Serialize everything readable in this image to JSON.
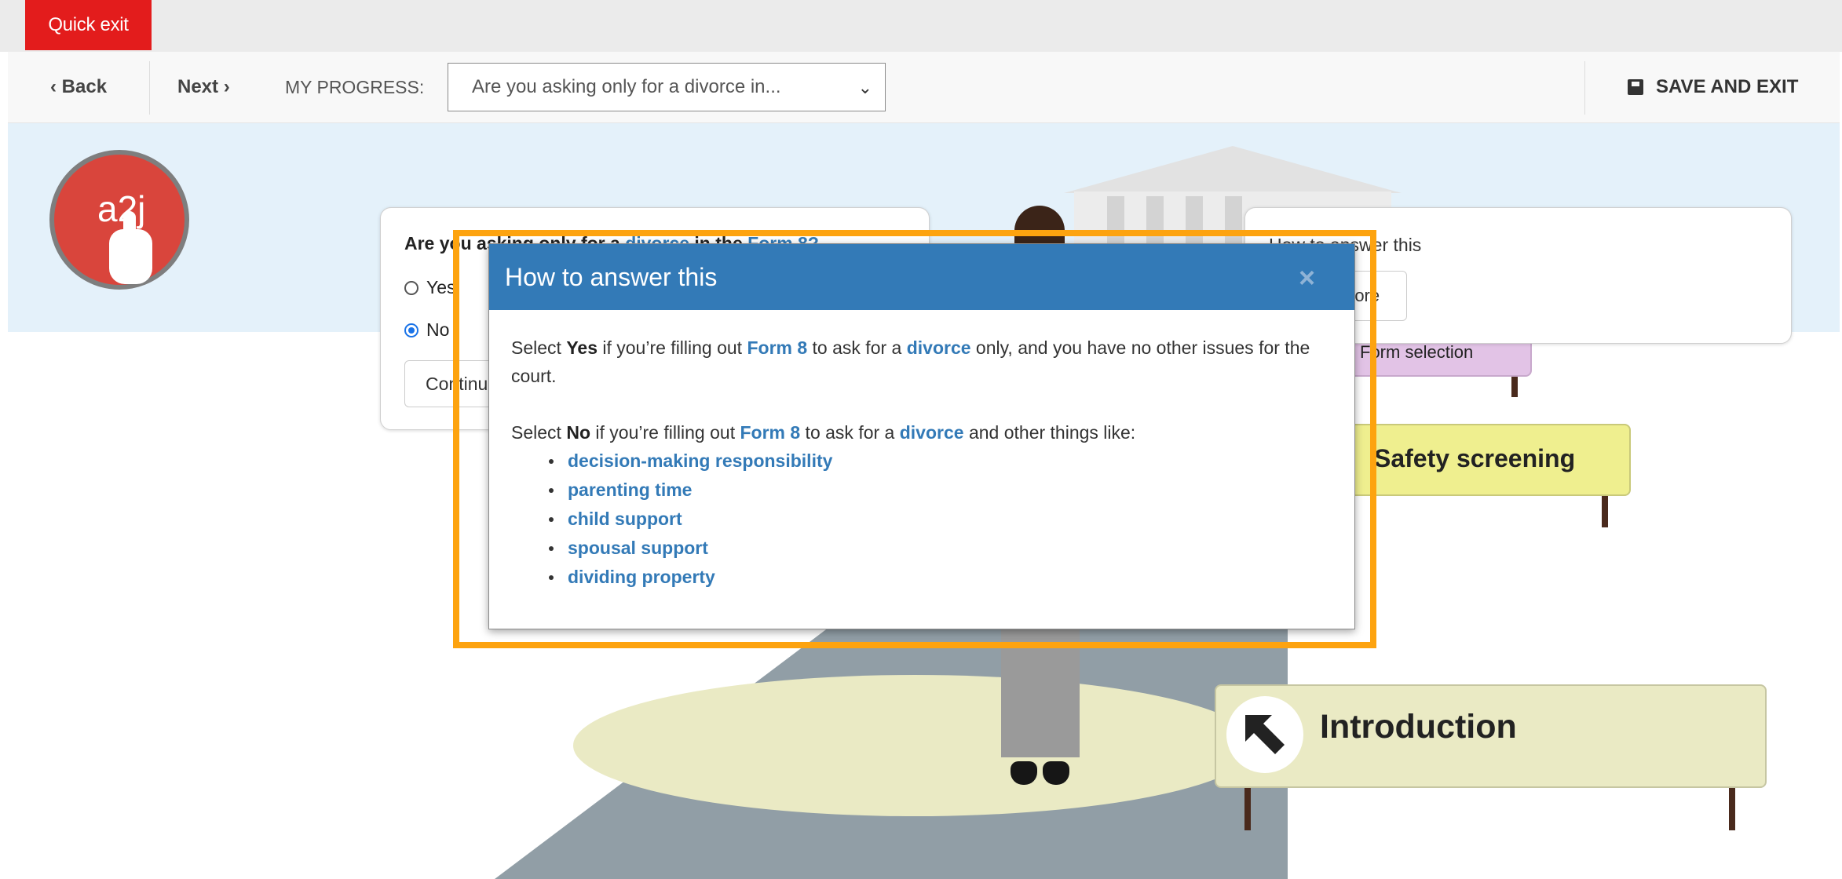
{
  "topbar": {
    "quick_exit": "Quick exit"
  },
  "nav": {
    "back": "‹ Back",
    "next": "Next ›",
    "progress_label": "MY PROGRESS:",
    "progress_value": "Are you asking only for a divorce in...",
    "save_exit": "SAVE AND EXIT"
  },
  "logo": {
    "text": "a2j"
  },
  "question": {
    "title_prefix": "Are you asking only for a ",
    "title_link1": "divorce",
    "title_mid": " in the ",
    "title_link2": "Form 8?",
    "options": [
      "Yes",
      "No"
    ],
    "selected": "No",
    "continue_label": "Continue"
  },
  "help_card": {
    "title": "How to answer this",
    "more_label": "More"
  },
  "signs": {
    "intro": "Introduction",
    "safety": "Safety screening",
    "selection": "Form selection"
  },
  "modal": {
    "title": "How to answer this",
    "close": "×",
    "p1_a": "Select ",
    "p1_yes": "Yes",
    "p1_b": " if you’re filling out ",
    "p1_form": "Form 8",
    "p1_c": " to ask for a ",
    "p1_divorce": "divorce",
    "p1_d": " only, and you have no other issues for the court.",
    "p2_a": "Select ",
    "p2_no": "No",
    "p2_b": " if you’re filling out ",
    "p2_form": "Form 8",
    "p2_c": " to ask for a ",
    "p2_divorce": "divorce",
    "p2_d": " and other things like:",
    "items": [
      "decision-making responsibility",
      "parenting time",
      "child support",
      "spousal support",
      "dividing property"
    ]
  },
  "colors": {
    "quick_exit": "#e31c1c",
    "modal_header": "#337ab7",
    "highlight": "#fda30f",
    "hero": "#e4f1fa",
    "logo": "#d9453c"
  }
}
